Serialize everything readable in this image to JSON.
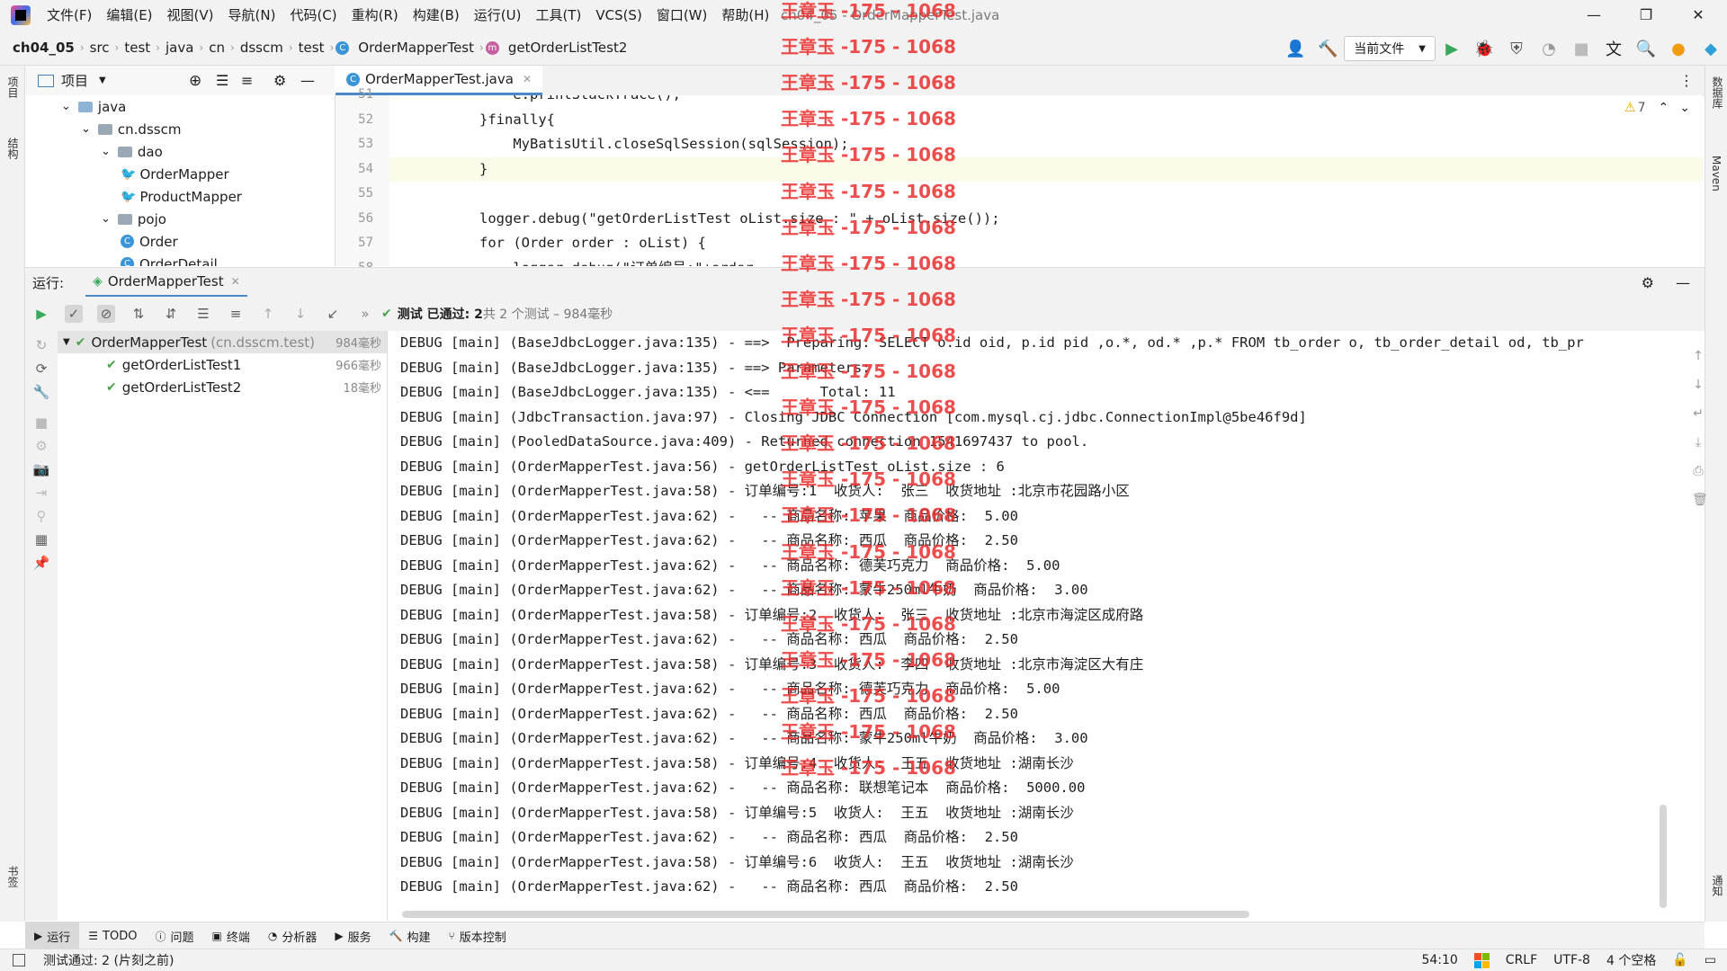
{
  "menu": [
    "文件(F)",
    "编辑(E)",
    "视图(V)",
    "导航(N)",
    "代码(C)",
    "重构(R)",
    "构建(B)",
    "运行(U)",
    "工具(T)",
    "VCS(S)",
    "窗口(W)",
    "帮助(H)"
  ],
  "window_title": "ch04_05 - OrderMapperTest.java",
  "window_controls": {
    "minimize": "—",
    "maximize": "❐",
    "close": "✕"
  },
  "breadcrumbs": [
    "ch04_05",
    "src",
    "test",
    "java",
    "cn",
    "dsscm",
    "test",
    "OrderMapperTest",
    "getOrderListTest2"
  ],
  "run_config": "当前文件",
  "project_panel": {
    "title": "项目"
  },
  "project_tree": [
    {
      "label": "java",
      "icon": "folder-icon",
      "indent": 1
    },
    {
      "label": "cn.dsscm",
      "icon": "package-icon",
      "indent": 2
    },
    {
      "label": "dao",
      "icon": "package-icon",
      "indent": 3
    },
    {
      "label": "OrderMapper",
      "icon": "mybatis-icon",
      "indent": 4
    },
    {
      "label": "ProductMapper",
      "icon": "mybatis-icon",
      "indent": 4
    },
    {
      "label": "pojo",
      "icon": "package-icon",
      "indent": 3
    },
    {
      "label": "Order",
      "icon": "class-icon",
      "indent": 4
    },
    {
      "label": "OrderDetail",
      "icon": "class-icon",
      "indent": 4
    }
  ],
  "editor_tab": "OrderMapperTest.java",
  "warnings": "7",
  "editor": {
    "lines": [
      {
        "n": "51",
        "text": "    e.printStackTrace();"
      },
      {
        "n": "52",
        "text": "}finally{"
      },
      {
        "n": "53",
        "text": "    MyBatisUtil.closeSqlSession(sqlSession);"
      },
      {
        "n": "54",
        "text": "}"
      },
      {
        "n": "55",
        "text": ""
      },
      {
        "n": "56",
        "text": "logger.debug(\"getOrderListTest oList.size : \" + oList.size());"
      },
      {
        "n": "57",
        "text": "for (Order order : oList) {"
      },
      {
        "n": "58",
        "text": "    logger.debug(\"订单编号:\"+order..."
      }
    ]
  },
  "run": {
    "label": "运行:",
    "tab": "OrderMapperTest",
    "status": "测试 已通过: 2",
    "status_detail": "共 2 个测试 – 984毫秒"
  },
  "tests": {
    "root": {
      "name": "OrderMapperTest",
      "pkg": "(cn.dsscm.test)",
      "time": "984毫秒"
    },
    "children": [
      {
        "name": "getOrderListTest1",
        "time": "966毫秒"
      },
      {
        "name": "getOrderListTest2",
        "time": "18毫秒"
      }
    ]
  },
  "console": [
    "DEBUG [main] (BaseJdbcLogger.java:135) - ==>  Preparing: SELECT o.id oid, p.id pid ,o.*, od.* ,p.* FROM tb_order o, tb_order_detail od, tb_pr",
    "DEBUG [main] (BaseJdbcLogger.java:135) - ==> Parameters: ",
    "DEBUG [main] (BaseJdbcLogger.java:135) - <==      Total: 11",
    "DEBUG [main] (JdbcTransaction.java:97) - Closing JDBC Connection [com.mysql.cj.jdbc.ConnectionImpl@5be46f9d]",
    "DEBUG [main] (PooledDataSource.java:409) - Returned connection 1541697437 to pool.",
    "DEBUG [main] (OrderMapperTest.java:56) - getOrderListTest oList.size : 6",
    "DEBUG [main] (OrderMapperTest.java:58) - 订单编号:1  收货人:  张三  收货地址 :北京市花园路小区",
    "DEBUG [main] (OrderMapperTest.java:62) -   -- 商品名称: 苹果  商品价格:  5.00",
    "DEBUG [main] (OrderMapperTest.java:62) -   -- 商品名称: 西瓜  商品价格:  2.50",
    "DEBUG [main] (OrderMapperTest.java:62) -   -- 商品名称: 德芙巧克力  商品价格:  5.00",
    "DEBUG [main] (OrderMapperTest.java:62) -   -- 商品名称: 蒙牛250ml牛奶  商品价格:  3.00",
    "DEBUG [main] (OrderMapperTest.java:58) - 订单编号:2  收货人:  张三  收货地址 :北京市海淀区成府路",
    "DEBUG [main] (OrderMapperTest.java:62) -   -- 商品名称: 西瓜  商品价格:  2.50",
    "DEBUG [main] (OrderMapperTest.java:58) - 订单编号:3  收货人:  李四  收货地址 :北京市海淀区大有庄",
    "DEBUG [main] (OrderMapperTest.java:62) -   -- 商品名称: 德芙巧克力  商品价格:  5.00",
    "DEBUG [main] (OrderMapperTest.java:62) -   -- 商品名称: 西瓜  商品价格:  2.50",
    "DEBUG [main] (OrderMapperTest.java:62) -   -- 商品名称: 蒙牛250ml牛奶  商品价格:  3.00",
    "DEBUG [main] (OrderMapperTest.java:58) - 订单编号:4  收货人:  王五  收货地址 :湖南长沙",
    "DEBUG [main] (OrderMapperTest.java:62) -   -- 商品名称: 联想笔记本  商品价格:  5000.00",
    "DEBUG [main] (OrderMapperTest.java:58) - 订单编号:5  收货人:  王五  收货地址 :湖南长沙",
    "DEBUG [main] (OrderMapperTest.java:62) -   -- 商品名称: 西瓜  商品价格:  2.50",
    "DEBUG [main] (OrderMapperTest.java:58) - 订单编号:6  收货人:  王五  收货地址 :湖南长沙",
    "DEBUG [main] (OrderMapperTest.java:62) -   -- 商品名称: 西瓜  商品价格:  2.50"
  ],
  "bottom_tabs": [
    "运行",
    "TODO",
    "问题",
    "终端",
    "分析器",
    "服务",
    "构建",
    "版本控制"
  ],
  "status_bar": {
    "message": "测试通过: 2 (片刻之前)",
    "position": "54:10",
    "line_sep": "CRLF",
    "encoding": "UTF-8",
    "indent": "4 个空格"
  },
  "side_labels": {
    "left_top": "项目",
    "left_mid": "结构",
    "left_bottom": "书签",
    "right_top": "数据库",
    "right_mid": "Maven",
    "right_bottom": "通知"
  },
  "watermark": "王章玉 -175 - 1068"
}
